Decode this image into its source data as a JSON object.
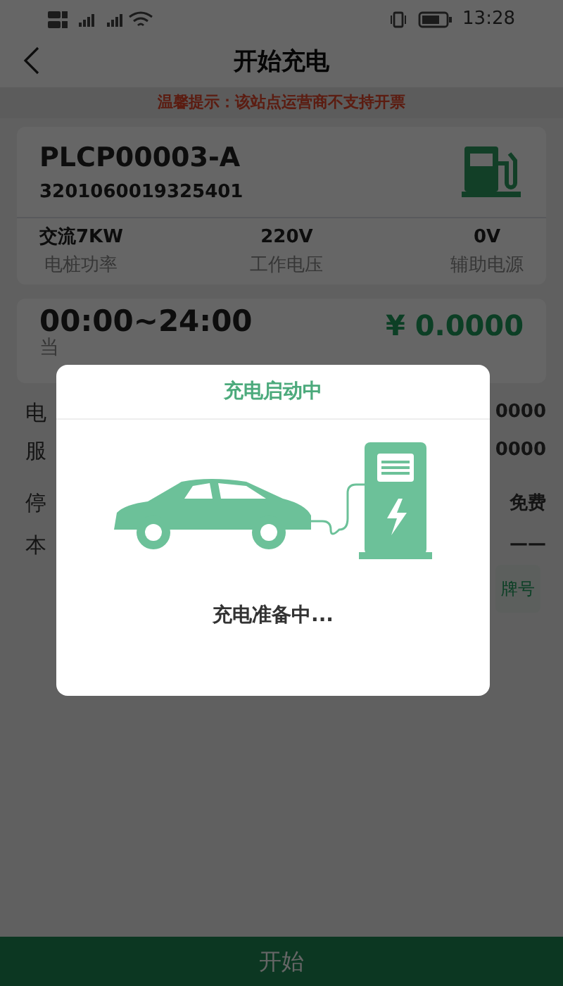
{
  "status_bar": {
    "time": "13:28"
  },
  "header": {
    "title": "开始充电"
  },
  "notice": "温馨提示：该站点运营商不支持开票",
  "charger": {
    "code": "PLCP00003-A",
    "serial": "3201060019325401",
    "specs": [
      {
        "value": "交流7KW",
        "label": "电桩功率"
      },
      {
        "value": "220V",
        "label": "工作电压"
      },
      {
        "value": "0V",
        "label": "辅助电源"
      }
    ]
  },
  "rate": {
    "period": "00:00~24:00",
    "label": "当",
    "price": "¥ 0.0000"
  },
  "fee_rows": [
    {
      "label": "电",
      "value": "0000"
    },
    {
      "label": "服",
      "value": "0000"
    },
    {
      "label": "停",
      "value": "免费"
    },
    {
      "label": "本",
      "value": "——"
    }
  ],
  "plate_button": "牌号",
  "start_button": "开始",
  "dialog": {
    "title": "充电启动中",
    "message": "充电准备中..."
  }
}
